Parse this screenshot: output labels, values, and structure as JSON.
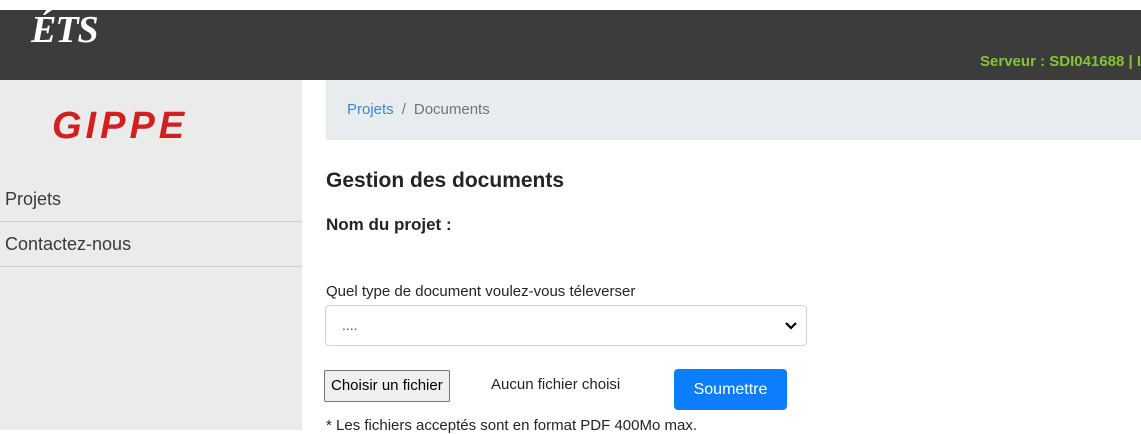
{
  "header": {
    "logo_text": "ÉTS",
    "server_text": "Serveur : SDI041688 | I"
  },
  "sidebar": {
    "logo_text": "GIPPE",
    "items": [
      {
        "label": "Projets"
      },
      {
        "label": "Contactez-nous"
      }
    ]
  },
  "breadcrumb": {
    "items": [
      "Projets",
      "Documents"
    ],
    "separator": "/"
  },
  "main": {
    "title": "Gestion des documents",
    "project_label": "Nom du projet :",
    "doc_type_label": "Quel type de document voulez-vous téleverser",
    "doc_type_value": "....",
    "file_button": "Choisir un fichier",
    "file_status": "Aucun fichier choisi",
    "submit_label": "Soumettre",
    "note": "* Les fichiers acceptés sont en format PDF 400Mo max."
  },
  "colors": {
    "header_bg": "#3c3c3c",
    "server_text": "#86c433",
    "gippe_red": "#d21f1f",
    "primary": "#0d7dff",
    "link": "#3b86d8"
  }
}
